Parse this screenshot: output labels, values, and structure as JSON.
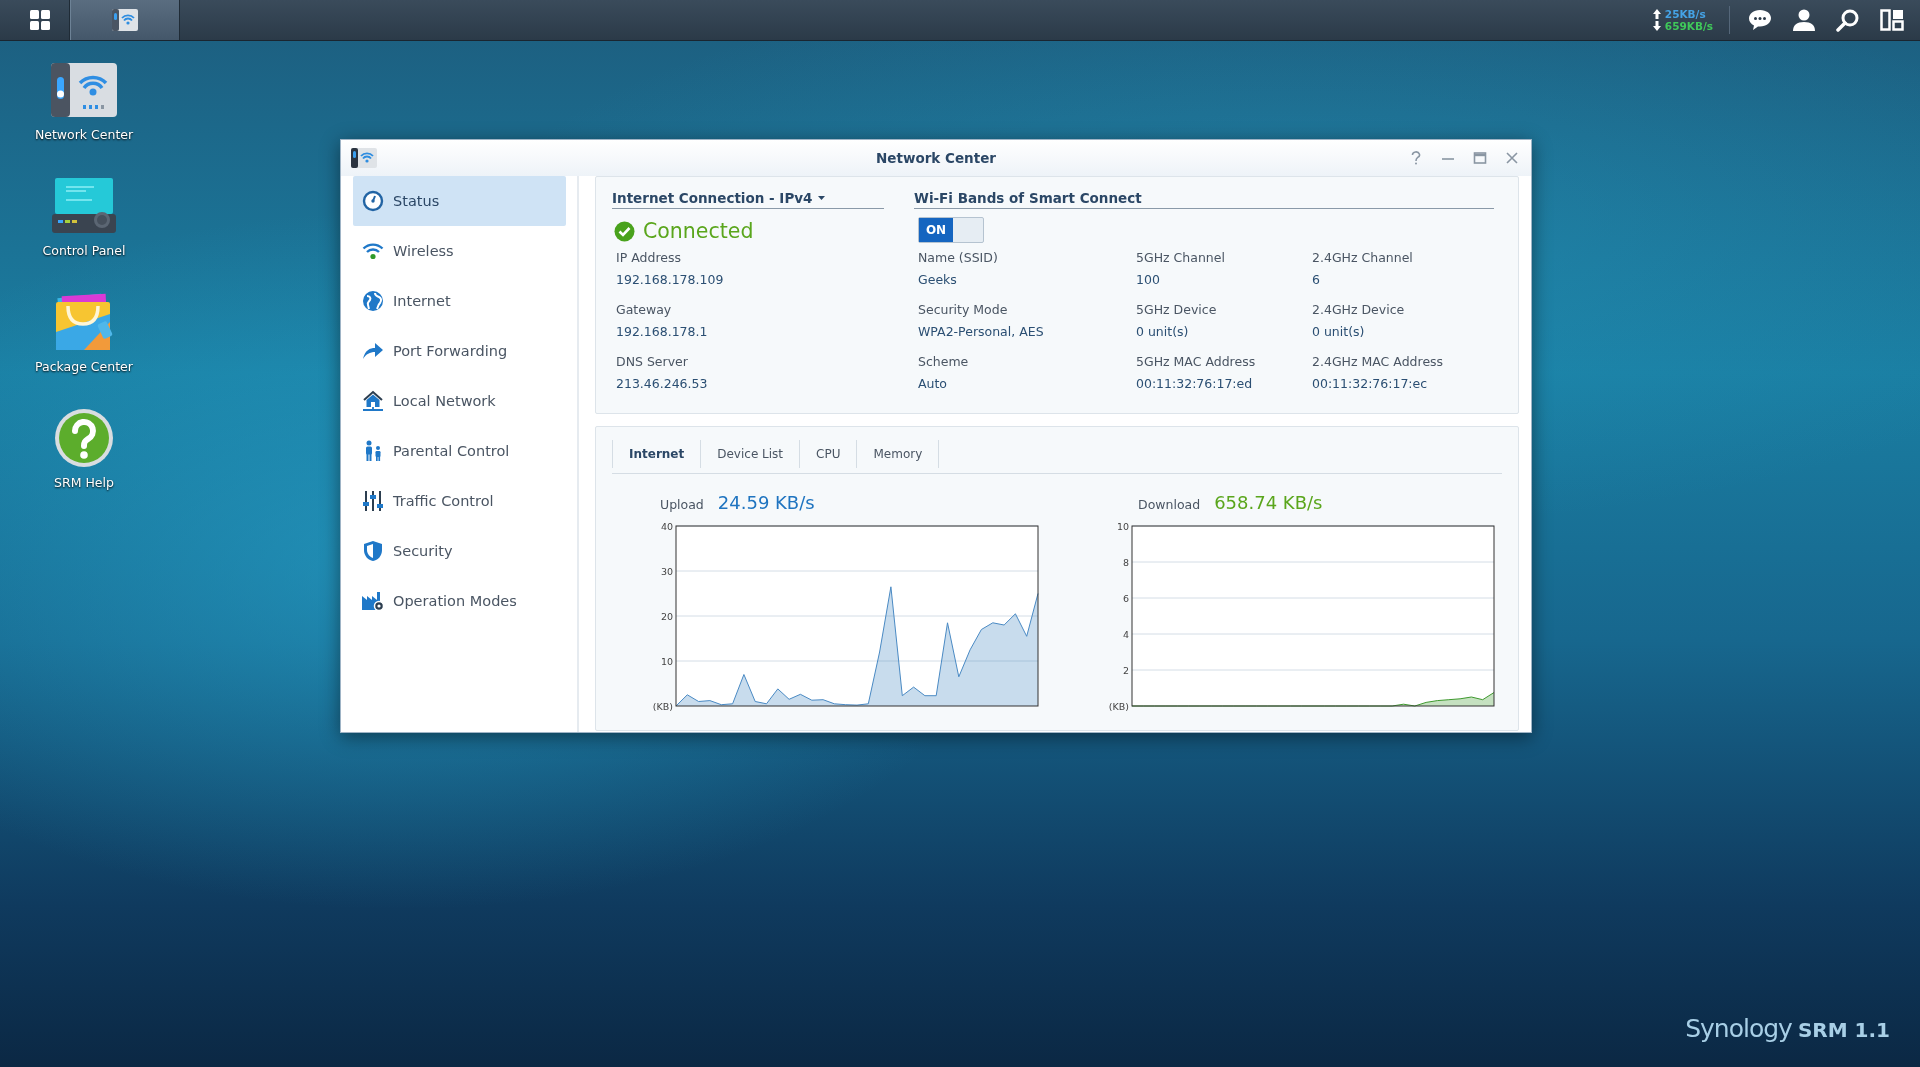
{
  "taskbar": {
    "apps": [
      {
        "kind": "main-menu",
        "selected": false
      },
      {
        "kind": "network-center",
        "selected": true
      }
    ],
    "upload_speed": "25KB/s",
    "download_speed": "659KB/s"
  },
  "desktop_icons": [
    {
      "kind": "network-center",
      "label": "Network Center"
    },
    {
      "kind": "control-panel",
      "label": "Control Panel"
    },
    {
      "kind": "package-center",
      "label": "Package Center"
    },
    {
      "kind": "help",
      "label": "SRM Help"
    }
  ],
  "window": {
    "title": "Network Center",
    "sidebar": {
      "items": [
        {
          "kind": "status",
          "label": "Status",
          "selected": true
        },
        {
          "kind": "wireless",
          "label": "Wireless",
          "selected": false
        },
        {
          "kind": "internet",
          "label": "Internet",
          "selected": false
        },
        {
          "kind": "port-forwarding",
          "label": "Port Forwarding",
          "selected": false
        },
        {
          "kind": "local-network",
          "label": "Local Network",
          "selected": false
        },
        {
          "kind": "parental-control",
          "label": "Parental Control",
          "selected": false
        },
        {
          "kind": "traffic-control",
          "label": "Traffic Control",
          "selected": false
        },
        {
          "kind": "security",
          "label": "Security",
          "selected": false
        },
        {
          "kind": "operation-modes",
          "label": "Operation Modes",
          "selected": false
        }
      ]
    },
    "internet": {
      "title": "Internet Connection - IPv4",
      "status": "Connected",
      "connected": true,
      "fields": [
        {
          "label": "IP Address",
          "value": "192.168.178.109"
        },
        {
          "label": "Gateway",
          "value": "192.168.178.1"
        },
        {
          "label": "DNS Server",
          "value": "213.46.246.53"
        }
      ]
    },
    "wifi": {
      "title": "Wi-Fi Bands of Smart Connect",
      "toggle": {
        "label": "ON",
        "on": true
      },
      "fields": [
        {
          "label": "Name (SSID)",
          "value": "Geeks"
        },
        {
          "label": "5GHz Channel",
          "value": "100"
        },
        {
          "label": "2.4GHz Channel",
          "value": "6"
        },
        {
          "label": "Security Mode",
          "value": "WPA2-Personal, AES"
        },
        {
          "label": "5GHz Device",
          "value": "0 unit(s)"
        },
        {
          "label": "2.4GHz Device",
          "value": "0 unit(s)"
        },
        {
          "label": "Scheme",
          "value": "Auto"
        },
        {
          "label": "5GHz MAC Address",
          "value": "00:11:32:76:17:ed"
        },
        {
          "label": "2.4GHz MAC Address",
          "value": "00:11:32:76:17:ec"
        }
      ]
    },
    "tabs": [
      {
        "label": "Internet",
        "selected": true
      },
      {
        "label": "Device List",
        "selected": false
      },
      {
        "label": "CPU",
        "selected": false
      },
      {
        "label": "Memory",
        "selected": false
      }
    ],
    "upload": {
      "label": "Upload",
      "value": "24.59 KB/s",
      "chart_data": {
        "type": "area",
        "grid": true,
        "ylim": [
          0,
          40
        ],
        "yticks": [
          {
            "value": 0,
            "label": "(KB)"
          },
          10,
          20,
          30,
          40
        ],
        "series": [
          {
            "color": "#4a8ac4",
            "values": [
              0,
              2.5,
              1,
              1.2,
              0.3,
              0.5,
              7,
              1,
              0.5,
              3.8,
              1.5,
              2.6,
              1.3,
              1.4,
              0.5,
              0.3,
              0.2,
              0.5,
              12,
              26.5,
              2.3,
              4.2,
              2.3,
              2.3,
              18.5,
              6.5,
              12.5,
              17,
              18.5,
              18,
              20.5,
              15.5,
              25
            ]
          }
        ]
      }
    },
    "download": {
      "label": "Download",
      "value": "658.74 KB/s",
      "chart_data": {
        "type": "area",
        "grid": true,
        "ylim": [
          0,
          10
        ],
        "yticks": [
          {
            "value": 0,
            "label": "(KB)"
          },
          2,
          4,
          6,
          8,
          10
        ],
        "series": [
          {
            "color": "#3f9a2f",
            "values": [
              0,
              0,
              0,
              0,
              0,
              0,
              0,
              0,
              0,
              0,
              0,
              0,
              0,
              0,
              0,
              0,
              0,
              0,
              0,
              0,
              0,
              0,
              0,
              0,
              0.1,
              0,
              0.2,
              0.3,
              0.35,
              0.4,
              0.5,
              0.35,
              0.75
            ]
          }
        ]
      }
    }
  },
  "brand": {
    "name": "Synology",
    "product": "SRM 1.1"
  }
}
